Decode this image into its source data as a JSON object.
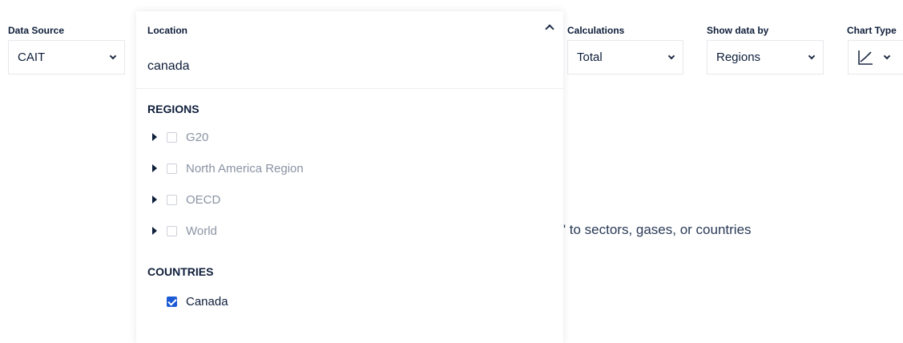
{
  "filters": {
    "data_source": {
      "label": "Data Source",
      "value": "CAIT"
    },
    "calculations": {
      "label": "Calculations",
      "value": "Total"
    },
    "show_data_by": {
      "label": "Show data by",
      "value": "Regions"
    },
    "chart_type": {
      "label": "Chart Type",
      "icon": "line-chart-icon"
    }
  },
  "location_dropdown": {
    "label": "Location",
    "search_value": "canada",
    "regions_heading": "REGIONS",
    "regions": [
      {
        "label": "G20",
        "checked": false
      },
      {
        "label": "North America Region",
        "checked": false
      },
      {
        "label": "OECD",
        "checked": false
      },
      {
        "label": "World",
        "checked": false
      }
    ],
    "countries_heading": "COUNTRIES",
    "countries": [
      {
        "label": "Canada",
        "checked": true
      }
    ]
  },
  "background_message": "\" to sectors, gases, or countries",
  "colors": {
    "checkbox_checked": "#1c5bd6",
    "text_primary": "#0e1e3a",
    "text_disabled": "#8a93a3"
  }
}
